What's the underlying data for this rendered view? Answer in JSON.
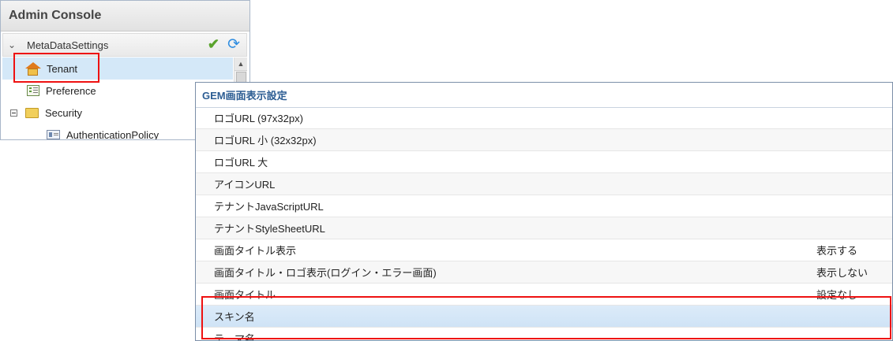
{
  "console": {
    "title": "Admin Console",
    "root_label": "MetaDataSettings",
    "items": [
      {
        "label": "Tenant",
        "icon": "house-icon"
      },
      {
        "label": "Preference",
        "icon": "list-icon"
      },
      {
        "label": "Security",
        "icon": "folder-icon"
      },
      {
        "label": "AuthenticationPolicy",
        "icon": "card-icon"
      }
    ]
  },
  "settings": {
    "title": "GEM画面表示設定",
    "rows": [
      {
        "key": "ロゴURL (97x32px)",
        "value": ""
      },
      {
        "key": "ロゴURL 小 (32x32px)",
        "value": ""
      },
      {
        "key": "ロゴURL 大",
        "value": ""
      },
      {
        "key": "アイコンURL",
        "value": ""
      },
      {
        "key": "テナントJavaScriptURL",
        "value": ""
      },
      {
        "key": "テナントStyleSheetURL",
        "value": ""
      },
      {
        "key": "画面タイトル表示",
        "value": "表示する"
      },
      {
        "key": "画面タイトル・ロゴ表示(ログイン・エラー画面)",
        "value": "表示しない"
      },
      {
        "key": "画面タイトル",
        "value": "設定なし"
      },
      {
        "key": "スキン名",
        "value": ""
      },
      {
        "key": "テーマ名",
        "value": ""
      }
    ]
  }
}
